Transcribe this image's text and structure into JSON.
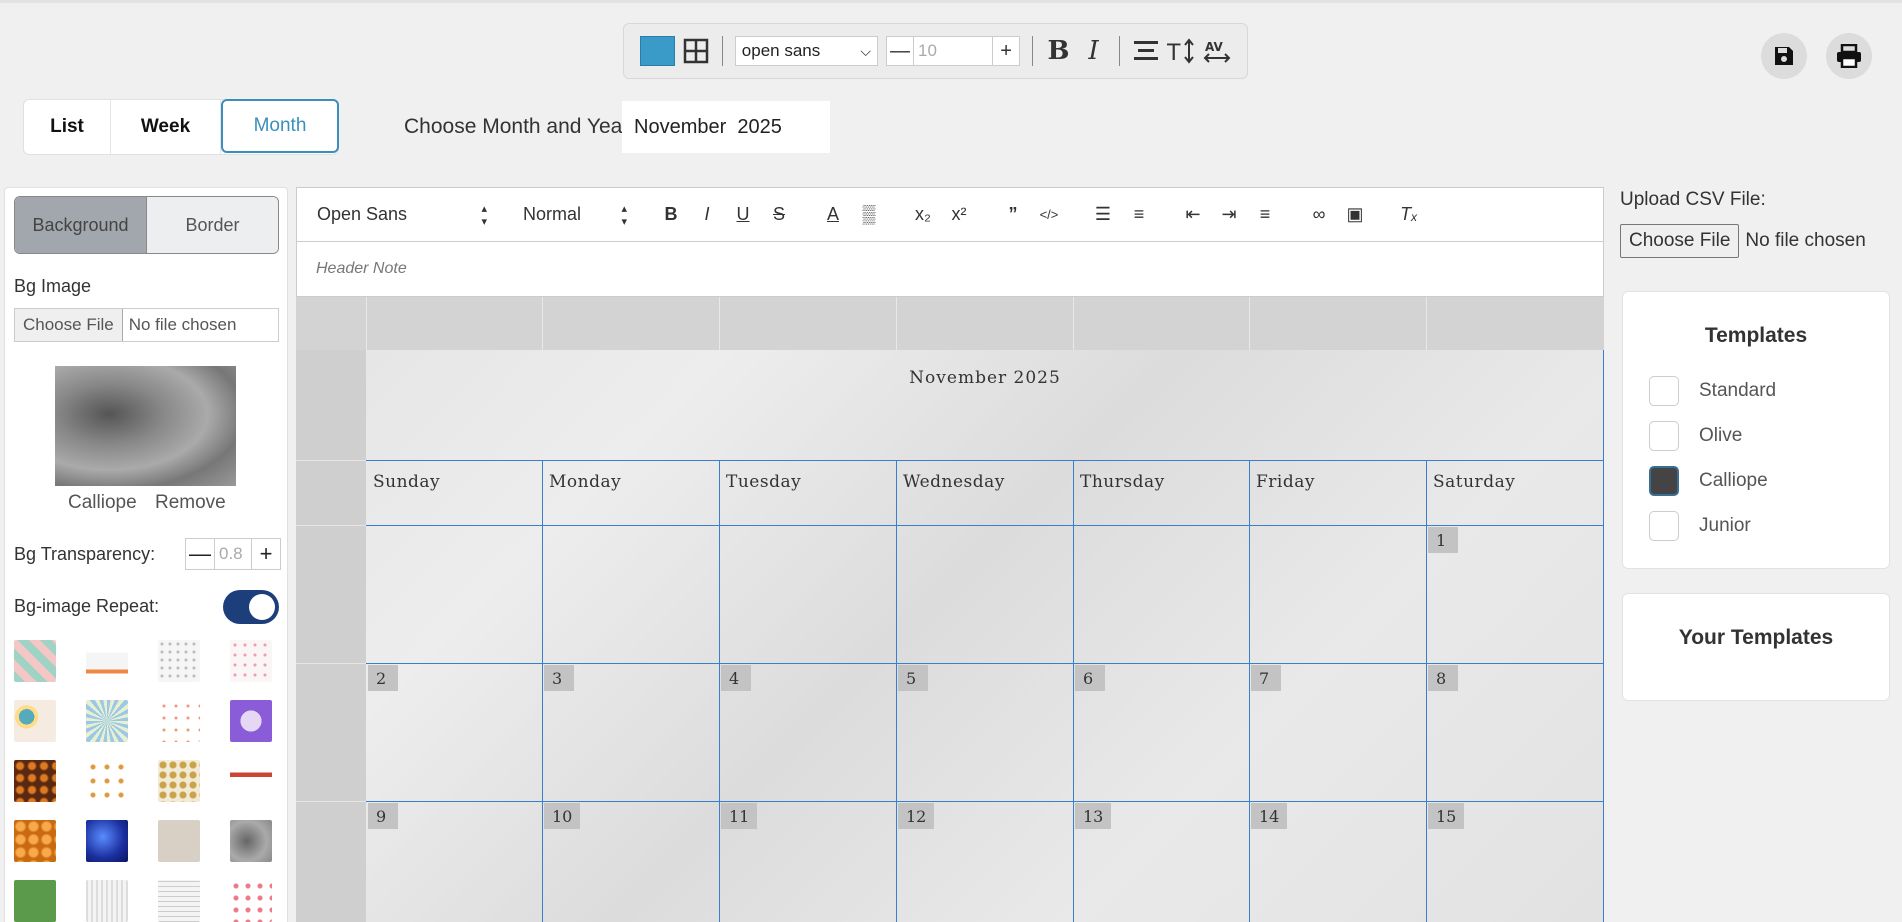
{
  "toolbar": {
    "color": "#3a9bc9",
    "font_value": "open sans",
    "size_placeholder": "10",
    "minus": "—",
    "plus": "+",
    "bold": "B",
    "italic": "I"
  },
  "view_tabs": [
    "List",
    "Week",
    "Month"
  ],
  "active_view": "Month",
  "month_picker": {
    "label": "Choose Month and Year:",
    "value": "November  2025"
  },
  "left_panel": {
    "tabs": [
      "Background",
      "Border"
    ],
    "bg_image_label": "Bg Image",
    "file_button": "Choose File",
    "file_status": "No file chosen",
    "image_name": "Calliope",
    "remove_label": "Remove",
    "transparency_label": "Bg Transparency:",
    "transparency_value": "0.8",
    "repeat_label": "Bg-image Repeat:",
    "repeat_on": true
  },
  "editor": {
    "font_select": "Open Sans",
    "size_select": "Normal",
    "header_placeholder": "Header Note"
  },
  "calendar": {
    "title": "November 2025",
    "days": [
      "Sunday",
      "Monday",
      "Tuesday",
      "Wednesday",
      "Thursday",
      "Friday",
      "Saturday"
    ],
    "weeks": [
      [
        "",
        "",
        "",
        "",
        "",
        "",
        "1"
      ],
      [
        "2",
        "3",
        "4",
        "5",
        "6",
        "7",
        "8"
      ],
      [
        "9",
        "10",
        "11",
        "12",
        "13",
        "14",
        "15"
      ]
    ]
  },
  "right_panel": {
    "csv_label": "Upload CSV File:",
    "file_button": "Choose File",
    "file_status": "No file chosen",
    "templates_title": "Templates",
    "templates": [
      {
        "name": "Standard",
        "checked": false
      },
      {
        "name": "Olive",
        "checked": false
      },
      {
        "name": "Calliope",
        "checked": true
      },
      {
        "name": "Junior",
        "checked": false
      }
    ],
    "your_templates_title": "Your Templates"
  }
}
